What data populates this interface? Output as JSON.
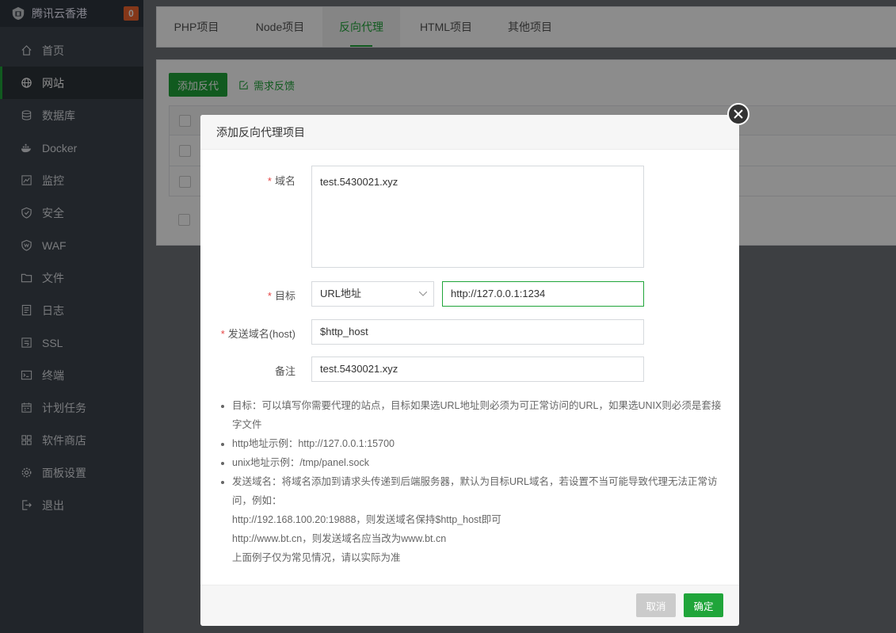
{
  "brand": {
    "name": "腾讯云香港",
    "badge": "0"
  },
  "sidebar": {
    "items": [
      {
        "label": "首页",
        "icon": "home-icon"
      },
      {
        "label": "网站",
        "icon": "globe-icon",
        "active": true
      },
      {
        "label": "数据库",
        "icon": "database-icon"
      },
      {
        "label": "Docker",
        "icon": "docker-icon"
      },
      {
        "label": "监控",
        "icon": "monitor-icon"
      },
      {
        "label": "安全",
        "icon": "shield-icon"
      },
      {
        "label": "WAF",
        "icon": "waf-shield-icon"
      },
      {
        "label": "文件",
        "icon": "folder-icon"
      },
      {
        "label": "日志",
        "icon": "log-icon"
      },
      {
        "label": "SSL",
        "icon": "ssl-icon"
      },
      {
        "label": "终端",
        "icon": "terminal-icon"
      },
      {
        "label": "计划任务",
        "icon": "calendar-icon"
      },
      {
        "label": "软件商店",
        "icon": "store-icon"
      },
      {
        "label": "面板设置",
        "icon": "gear-icon"
      },
      {
        "label": "退出",
        "icon": "logout-icon"
      }
    ]
  },
  "tabs": [
    {
      "label": "PHP项目"
    },
    {
      "label": "Node项目"
    },
    {
      "label": "反向代理",
      "active": true
    },
    {
      "label": "HTML项目"
    },
    {
      "label": "其他项目"
    }
  ],
  "toolbar": {
    "add_label": "添加反代",
    "feedback_label": "需求反馈"
  },
  "dialog": {
    "title": "添加反向代理项目",
    "domain_label": "域名",
    "domain_value": "test.5430021.xyz",
    "target_label": "目标",
    "target_type": "URL地址",
    "target_value": "http://127.0.0.1:1234",
    "host_label": "发送域名(host)",
    "host_value": "$http_host",
    "remark_label": "备注",
    "remark_value": "test.5430021.xyz",
    "notes": {
      "n1": "目标：可以填写你需要代理的站点，目标如果选URL地址则必须为可正常访问的URL，如果选UNIX则必须是套接字文件",
      "n2": "http地址示例：http://127.0.0.1:15700",
      "n3": "unix地址示例：/tmp/panel.sock",
      "n4": "发送域名：将域名添加到请求头传递到后端服务器，默认为目标URL域名，若设置不当可能导致代理无法正常访问，例如：",
      "n4a": "http://192.168.100.20:19888，则发送域名保持$http_host即可",
      "n4b": "http://www.bt.cn，则发送域名应当改为www.bt.cn",
      "n4c": "上面例子仅为常见情况，请以实际为准"
    },
    "cancel_label": "取消",
    "ok_label": "确定"
  },
  "colors": {
    "accent": "#20a53a",
    "sidebar_bg": "#3c444d",
    "badge": "#f0642e",
    "required": "#e54545"
  }
}
